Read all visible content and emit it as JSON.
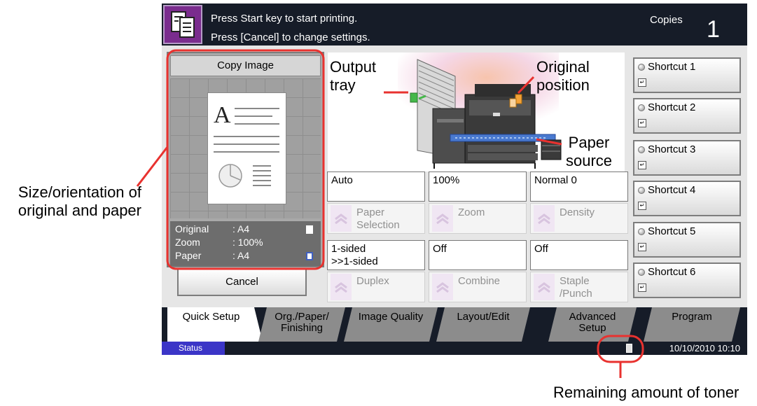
{
  "header": {
    "line1": "Press Start key to start printing.",
    "line2": "Press [Cancel] to change settings.",
    "copies_label": "Copies",
    "copies_value": "1"
  },
  "preview": {
    "title": "Copy Image",
    "rows": [
      {
        "key": "Original",
        "value": ": A4"
      },
      {
        "key": "Zoom",
        "value": ": 100%"
      },
      {
        "key": "Paper",
        "value": ": A4"
      }
    ]
  },
  "cancel_label": "Cancel",
  "functions": [
    {
      "value": "Auto",
      "label": "Paper Selection",
      "label_lines": [
        "Paper",
        "Selection"
      ]
    },
    {
      "value": "100%",
      "label": "Zoom",
      "label_lines": [
        "Zoom"
      ]
    },
    {
      "value": "Normal 0",
      "label": "Density",
      "label_lines": [
        "Density"
      ]
    },
    {
      "value": "1-sided >>1-sided",
      "value_lines": [
        "1-sided",
        ">>1-sided"
      ],
      "label": "Duplex",
      "label_lines": [
        "Duplex"
      ]
    },
    {
      "value": "Off",
      "label": "Combine",
      "label_lines": [
        "Combine"
      ]
    },
    {
      "value": "Off",
      "label": "Staple /Punch",
      "label_lines": [
        "Staple",
        "/Punch"
      ]
    }
  ],
  "shortcuts": [
    "Shortcut 1",
    "Shortcut 2",
    "Shortcut 3",
    "Shortcut 4",
    "Shortcut 5",
    "Shortcut 6"
  ],
  "tabs": [
    {
      "label": "Quick Setup",
      "lines": [
        "Quick Setup"
      ],
      "active": true
    },
    {
      "label": "Org./Paper/ Finishing",
      "lines": [
        "Org./Paper/",
        "Finishing"
      ]
    },
    {
      "label": "Image Quality",
      "lines": [
        "Image Quality"
      ]
    },
    {
      "label": "Layout/Edit",
      "lines": [
        "Layout/Edit"
      ]
    },
    {
      "label": "Advanced Setup",
      "lines": [
        "Advanced",
        "Setup"
      ]
    },
    {
      "label": "Program",
      "lines": [
        "Program"
      ]
    }
  ],
  "status": {
    "button": "Status",
    "datetime": "10/10/2010  10:10"
  },
  "machine_labels": {
    "output_tray": [
      "Output",
      "tray"
    ],
    "original_position": [
      "Original",
      "position"
    ],
    "paper_source": [
      "Paper",
      "source"
    ]
  },
  "annotations": {
    "size_orientation": [
      "Size/orientation of",
      "original and paper"
    ],
    "toner": "Remaining amount of toner"
  },
  "colors": {
    "header_bg": "#161c28",
    "copy_icon_bg": "#7a2c8e",
    "status_button": "#3b35c7",
    "callout_red": "#e8322f"
  },
  "icons": {
    "copy": "copy-document-icon",
    "toner": "toner-icon",
    "arrow": "up-chevron-icon",
    "shortcut_lamp": "indicator-lamp-icon"
  }
}
